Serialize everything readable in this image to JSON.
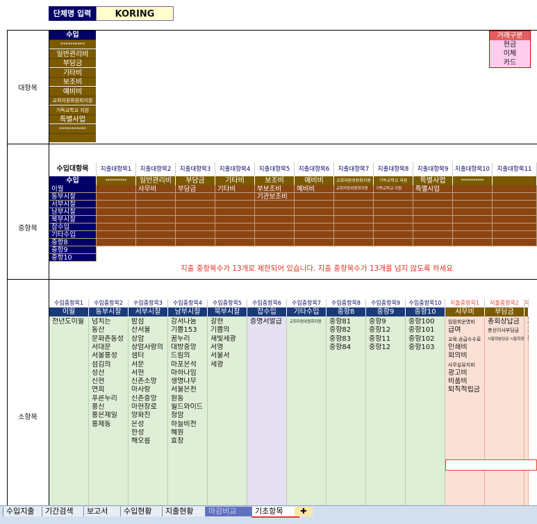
{
  "top": {
    "org_label": "단체명 입력",
    "org_value": "KORING"
  },
  "daehangmok": {
    "section_label": "대항목",
    "header": "수입",
    "items": [
      "**********",
      "일반관리비",
      "부담금",
      "기타비",
      "보조비",
      "예비비",
      "교회자원위원회지원",
      "기독교학교 지원",
      "특별사업",
      "***********",
      ""
    ]
  },
  "trade": {
    "title": "거래구분",
    "items": [
      "현금",
      "이체",
      "카드"
    ]
  },
  "junghangmok": {
    "section_label": "중항목",
    "columns": [
      "수입대항목",
      "지출대항목1",
      "지출대항목2",
      "지출대항목3",
      "지출대항목4",
      "지출대항목5",
      "지출대항목6",
      "지출대항목7",
      "지출대항목8",
      "지출대항목9",
      "지출대항목10",
      "지출대항목11"
    ],
    "headers": [
      "수입",
      "**********",
      "일반관리비",
      "부담금",
      "기타비",
      "보조비",
      "예비비",
      "교회자원위원회지원",
      "기독교학교 지원",
      "특별사업",
      "***********",
      ""
    ],
    "income_rows": [
      "이월",
      "동부시찰",
      "서부시찰",
      "남부시찰",
      "북부시찰",
      "잡수입",
      "기타수입",
      "중항8",
      "중항9",
      "중항10"
    ],
    "row1": [
      "사무비",
      "부담금",
      "기타비",
      "부보조비",
      "예비비",
      "교회자원위원회지원",
      "기독교학교 지원",
      "특별사업"
    ],
    "row2_extra": "기관보조비",
    "warning": "지출 중항목수가 13개로 제한되어 있습니다. 지출 중항목수가 13개를 넘지 않도록 하세요"
  },
  "sohangmok": {
    "section_label": "소항목",
    "columns": [
      "수입중항목1",
      "수입중항목2",
      "수입중항목3",
      "수입중항목4",
      "수입중항목5",
      "수입중항목6",
      "수입중항목7",
      "수입중항목8",
      "수입중항목9",
      "수입중항목10",
      "지출중항목1",
      "지출중항목2",
      "지"
    ],
    "headers": [
      "이월",
      "동부시찰",
      "서부시찰",
      "남부시찰",
      "북부시찰",
      "잡수입",
      "기타수입",
      "중항8",
      "중항9",
      "중항10",
      "사무비",
      "부담금",
      ""
    ],
    "col0": [
      "전년도이월"
    ],
    "col1": [
      "넘치는",
      "동산",
      "문화존동성",
      "서대문",
      "서울홍성",
      "섬김의",
      "성산",
      "신현",
      "연희",
      "푸른누리",
      "홍신",
      "홍은제일",
      "홍제동"
    ],
    "col2": [
      "밤섬",
      "산서울",
      "상암",
      "상암사랑의",
      "샘터",
      "서문",
      "서현",
      "신촌소망",
      "아사랑",
      "신촌중앙",
      "아현장로",
      "양화진",
      "은성",
      "한성",
      "해오름"
    ],
    "col3": [
      "강서나눔",
      "기쁨153",
      "꿈누리",
      "대방중앙",
      "드림의",
      "마포은석",
      "마하나임",
      "생명나무",
      "서울은천",
      "원동",
      "월드와이드",
      "청암",
      "하늘비전",
      "혜원",
      "효창"
    ],
    "col4": [
      "갈현",
      "기쁨의",
      "새빛세광",
      "서영",
      "서울서",
      "세광"
    ],
    "col5": [
      "증명서발급"
    ],
    "col6": [
      "교회자원위원회지원"
    ],
    "col7": [
      "중항81",
      "중항82",
      "중항83",
      "중항84"
    ],
    "col8": [
      "중항9",
      "중항12",
      "중항11",
      "중항12"
    ],
    "col9": [
      "중항100",
      "중항101",
      "중항102",
      "중항103"
    ],
    "col10": [
      "임원회운영비",
      "급여",
      "교육.승급수수료",
      "인쇄비",
      "회의비",
      "사무실유지비",
      "광고비",
      "비품비",
      "퇴직적립금"
    ],
    "col11": [
      "총회상납금",
      "총신이사부담금",
      "시찰회분담금 시찰회경비",
      ""
    ],
    "col12": [
      "과",
      "교",
      "원"
    ]
  },
  "sheet_tabs": [
    "수입지출",
    "기간검색",
    "보고서",
    "수입현황",
    "지출현황",
    "마감비교",
    "기초항목"
  ],
  "active_tab": "기초항목",
  "colors": {
    "navy": "#000066",
    "olive": "#7b5a00",
    "brown": "#8b4513",
    "green": "#dfeed7",
    "pink": "#fbe1d5",
    "lavender": "#e6e1f2",
    "trade_pink": "#ffccee"
  }
}
